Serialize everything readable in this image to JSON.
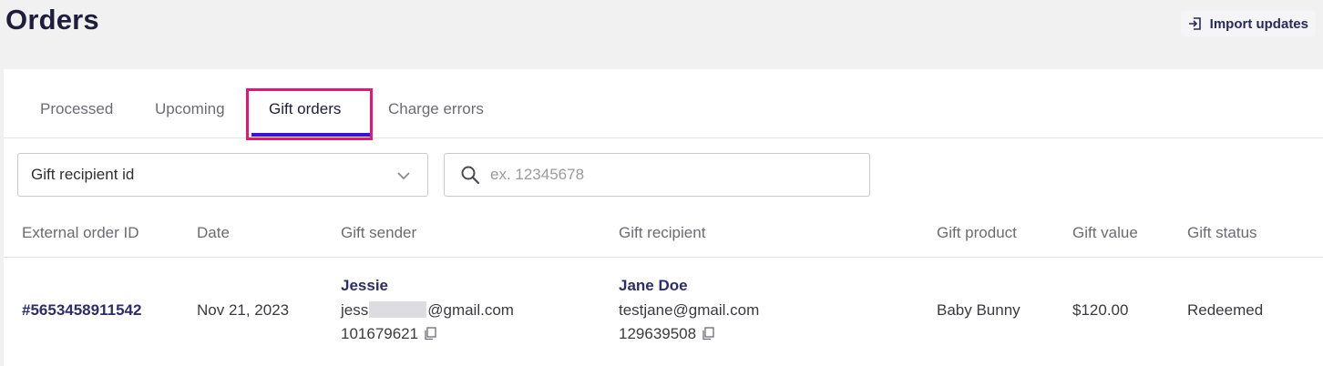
{
  "header": {
    "title": "Orders",
    "import_label": "Import updates"
  },
  "tabs": [
    {
      "label": "Processed"
    },
    {
      "label": "Upcoming"
    },
    {
      "label": "Gift orders"
    },
    {
      "label": "Charge errors"
    }
  ],
  "filter": {
    "selected": "Gift recipient id",
    "search_placeholder": "ex. 12345678"
  },
  "table": {
    "headers": [
      "External order ID",
      "Date",
      "Gift sender",
      "Gift recipient",
      "Gift product",
      "Gift value",
      "Gift status"
    ],
    "rows": [
      {
        "order_id": "#5653458911542",
        "date": "Nov 21, 2023",
        "sender": {
          "name": "Jessie",
          "email_prefix": "jess",
          "email_suffix": "@gmail.com",
          "id": "101679621"
        },
        "recipient": {
          "name": "Jane Doe",
          "email": "testjane@gmail.com",
          "id": "129639508"
        },
        "product": "Baby Bunny",
        "value": "$120.00",
        "status": "Redeemed"
      }
    ]
  },
  "colors": {
    "accent": "#3b12d9",
    "highlight": "#e6157a",
    "brand_text": "#2d2d6b"
  }
}
